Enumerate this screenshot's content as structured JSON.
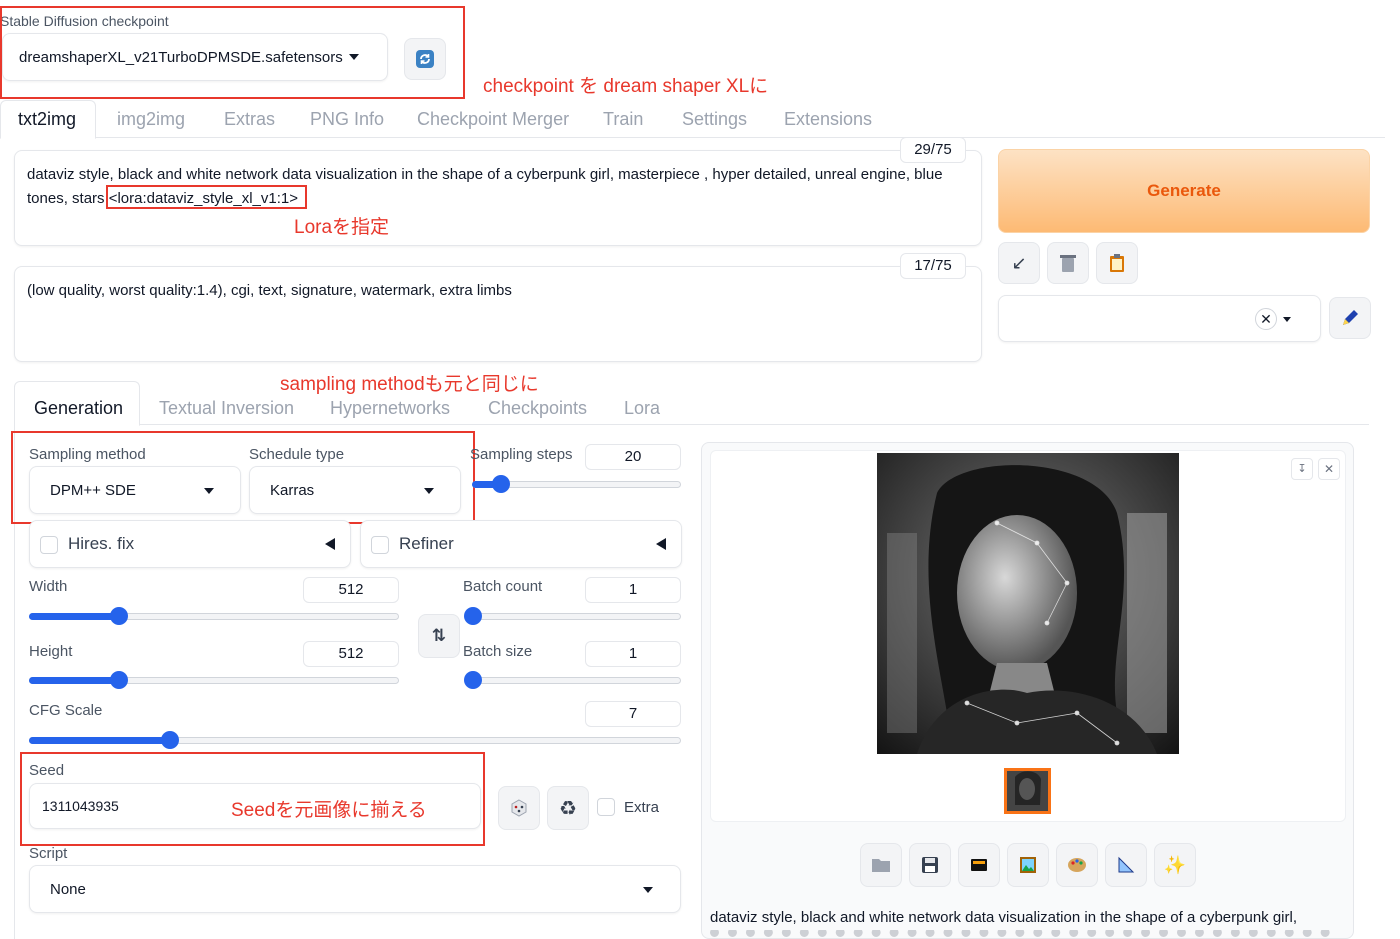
{
  "checkpoint": {
    "label": "Stable Diffusion checkpoint",
    "value": "dreamshaperXL_v21TurboDPMSDE.safetensors"
  },
  "main_tabs": [
    "txt2img",
    "img2img",
    "Extras",
    "PNG Info",
    "Checkpoint Merger",
    "Train",
    "Settings",
    "Extensions"
  ],
  "prompt": {
    "text_line1": "dataviz style, black and white network data visualization in the shape of a cyberpunk girl,  masterpiece , hyper detailed, unreal engine, blue",
    "text_line2_prefix": "tones, stars ",
    "lora_tag": "<lora:dataviz_style_xl_v1:1>",
    "token_count": "29/75"
  },
  "negative_prompt": {
    "text": "(low quality, worst quality:1.4), cgi,  text, signature, watermark, extra limbs",
    "token_count": "17/75"
  },
  "generate_label": "Generate",
  "sub_tabs": [
    "Generation",
    "Textual Inversion",
    "Hypernetworks",
    "Checkpoints",
    "Lora"
  ],
  "sampling": {
    "method_label": "Sampling method",
    "method_value": "DPM++ SDE",
    "schedule_label": "Schedule type",
    "schedule_value": "Karras",
    "steps_label": "Sampling steps",
    "steps_value": "20"
  },
  "hires_label": "Hires. fix",
  "refiner_label": "Refiner",
  "width": {
    "label": "Width",
    "value": "512",
    "fraction": 0.24
  },
  "height": {
    "label": "Height",
    "value": "512",
    "fraction": 0.24
  },
  "batch_count": {
    "label": "Batch count",
    "value": "1",
    "fraction": 0.0
  },
  "batch_size": {
    "label": "Batch size",
    "value": "1",
    "fraction": 0.0
  },
  "cfg": {
    "label": "CFG Scale",
    "value": "7",
    "fraction": 0.215
  },
  "steps_fraction": 0.135,
  "seed": {
    "label": "Seed",
    "value": "1311043935",
    "extra_label": "Extra"
  },
  "script": {
    "label": "Script",
    "value": "None"
  },
  "output_caption": "dataviz style, black and white network data visualization in the shape of a cyberpunk girl,",
  "annotations": {
    "checkpoint_note": "checkpoint を dream shaper XLに",
    "lora_note": "Loraを指定",
    "sampling_note": "sampling methodも元と同じに",
    "seed_note": "Seedを元画像に揃える"
  },
  "colors": {
    "accent": "#2563eb",
    "generate_text": "#ea580c",
    "annotation": "#e8382c"
  },
  "icons": {
    "refresh": "refresh-icon",
    "arrow": "arrow-down-left-icon",
    "trash": "trash-icon",
    "clipboard": "clipboard-icon",
    "pencil": "pencil-icon",
    "dice": "dice-icon",
    "recycle": "recycle-icon",
    "swap": "swap-icon"
  }
}
